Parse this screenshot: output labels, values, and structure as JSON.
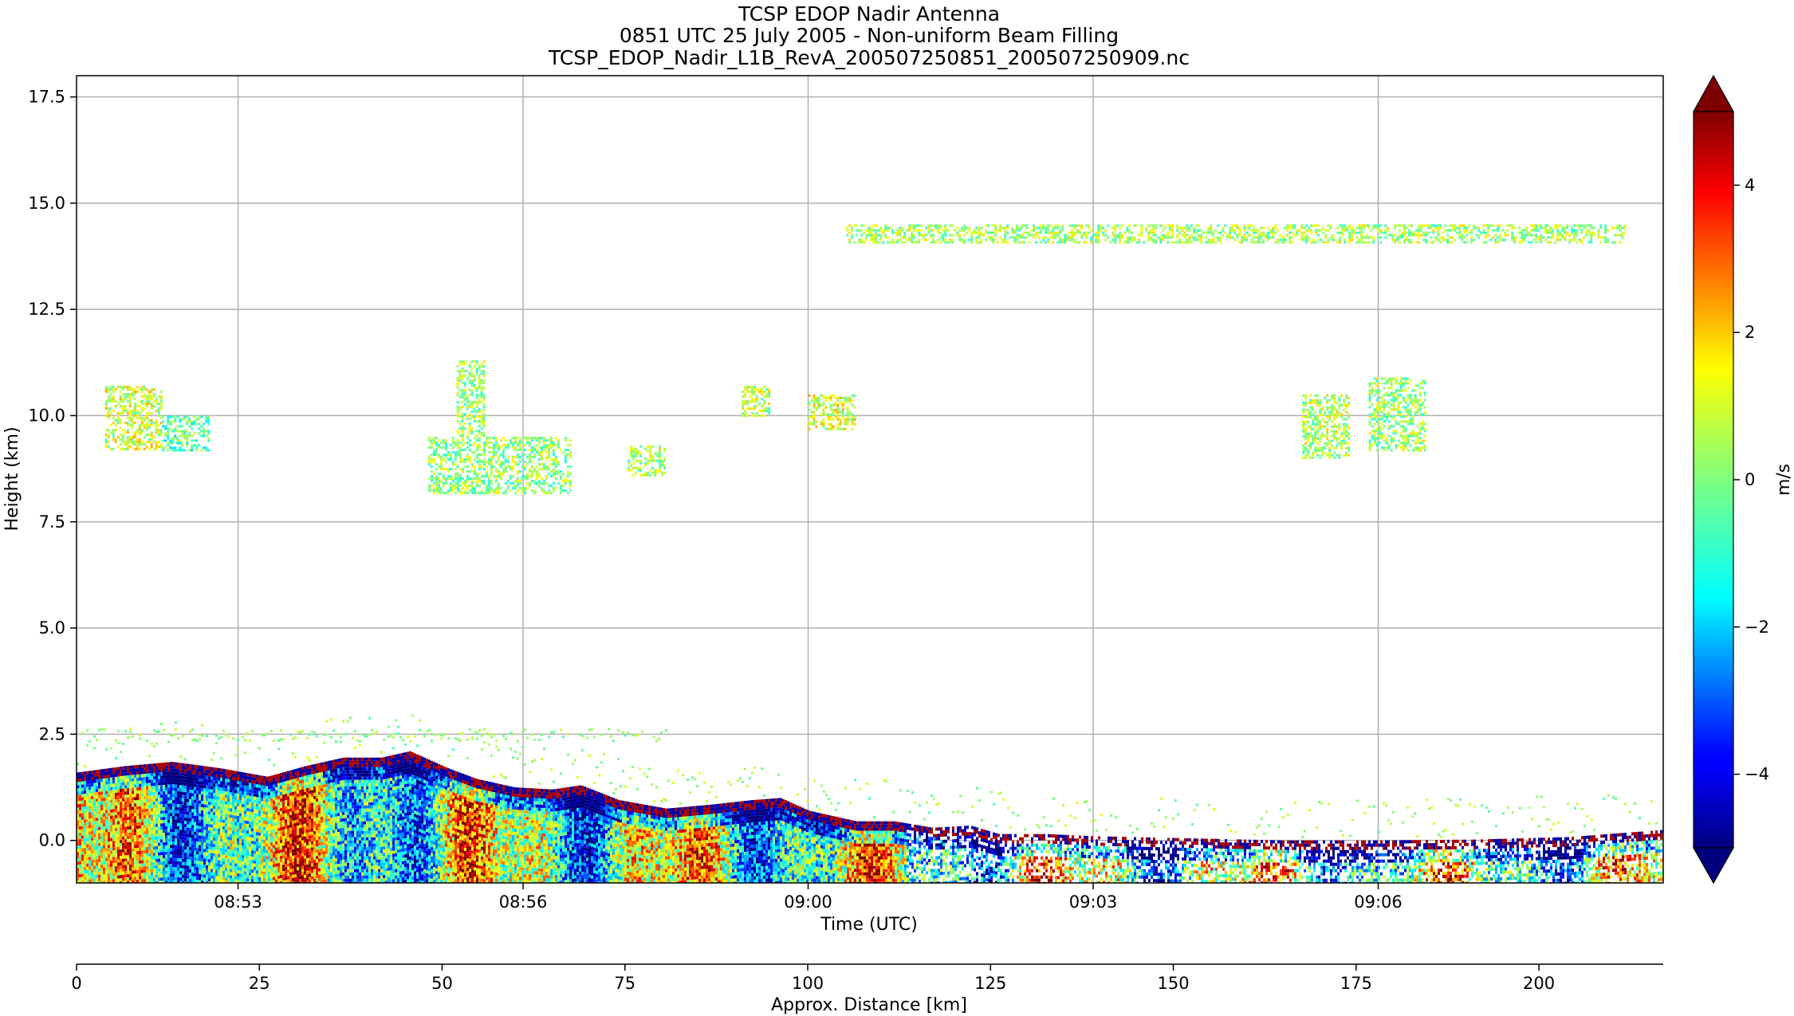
{
  "chart_data": {
    "type": "heatmap",
    "title": {
      "line1": "TCSP EDOP Nadir Antenna",
      "line2": "0851 UTC 25 July 2005 - Non-uniform Beam Filling",
      "line3": "TCSP_EDOP_Nadir_L1B_RevA_200507250851_200507250909.nc"
    },
    "xlabel": "Time (UTC)",
    "ylabel": "Height (km)",
    "x2label": "Approx. Distance [km]",
    "cbar_label": "m/s",
    "xlim_minutes": [
      531.3,
      548.0
    ],
    "ylim": [
      -1.0,
      18.0
    ],
    "x2lim": [
      0,
      217
    ],
    "clim": [
      -5,
      5
    ],
    "colormap": "jet",
    "colorbar_extend": "both",
    "grid": true,
    "x_ticks": [
      {
        "label": "08:53",
        "minute": 533
      },
      {
        "label": "08:56",
        "minute": 536
      },
      {
        "label": "09:00",
        "minute": 539
      },
      {
        "label": "09:03",
        "minute": 542
      },
      {
        "label": "09:06",
        "minute": 545
      }
    ],
    "y_ticks": [
      {
        "label": "0.0",
        "value": 0.0
      },
      {
        "label": "2.5",
        "value": 2.5
      },
      {
        "label": "5.0",
        "value": 5.0
      },
      {
        "label": "7.5",
        "value": 7.5
      },
      {
        "label": "10.0",
        "value": 10.0
      },
      {
        "label": "12.5",
        "value": 12.5
      },
      {
        "label": "15.0",
        "value": 15.0
      },
      {
        "label": "17.5",
        "value": 17.5
      }
    ],
    "x2_ticks": [
      {
        "label": "0",
        "value": 0
      },
      {
        "label": "25",
        "value": 25
      },
      {
        "label": "50",
        "value": 50
      },
      {
        "label": "75",
        "value": 75
      },
      {
        "label": "100",
        "value": 100
      },
      {
        "label": "125",
        "value": 125
      },
      {
        "label": "150",
        "value": 150
      },
      {
        "label": "175",
        "value": 175
      },
      {
        "label": "200",
        "value": 200
      }
    ],
    "cbar_ticks": [
      {
        "label": "4",
        "value": 4
      },
      {
        "label": "2",
        "value": 2
      },
      {
        "label": "0",
        "value": 0
      },
      {
        "label": "−2",
        "value": -2
      },
      {
        "label": "−4",
        "value": -4
      }
    ],
    "surface_echo_top_km": [
      [
        531.3,
        1.6
      ],
      [
        531.8,
        1.75
      ],
      [
        532.3,
        1.85
      ],
      [
        532.8,
        1.7
      ],
      [
        533.3,
        1.5
      ],
      [
        533.7,
        1.75
      ],
      [
        534.1,
        1.95
      ],
      [
        534.5,
        1.95
      ],
      [
        534.8,
        2.1
      ],
      [
        535.2,
        1.7
      ],
      [
        535.5,
        1.45
      ],
      [
        535.9,
        1.25
      ],
      [
        536.3,
        1.2
      ],
      [
        536.6,
        1.3
      ],
      [
        537.0,
        0.95
      ],
      [
        537.5,
        0.75
      ],
      [
        538.0,
        0.85
      ],
      [
        538.4,
        0.95
      ],
      [
        538.7,
        1.0
      ],
      [
        539.0,
        0.7
      ],
      [
        539.5,
        0.45
      ],
      [
        539.9,
        0.45
      ],
      [
        540.3,
        0.3
      ],
      [
        540.7,
        0.35
      ],
      [
        541.0,
        0.15
      ],
      [
        541.5,
        0.15
      ],
      [
        542.0,
        0.1
      ],
      [
        543.0,
        0.05
      ],
      [
        544.0,
        0.0
      ],
      [
        545.0,
        0.0
      ],
      [
        546.0,
        0.02
      ],
      [
        547.0,
        0.08
      ],
      [
        548.0,
        0.25
      ]
    ],
    "cloud_features": [
      {
        "minute_start": 531.6,
        "minute_end": 532.2,
        "bottom_km": 9.2,
        "top_km": 10.7,
        "mean_velocity": 0.8
      },
      {
        "minute_start": 532.2,
        "minute_end": 532.7,
        "bottom_km": 9.2,
        "top_km": 10.0,
        "mean_velocity": -0.5
      },
      {
        "minute_start": 535.3,
        "minute_end": 535.6,
        "bottom_km": 9.5,
        "top_km": 11.3,
        "mean_velocity": 0.3
      },
      {
        "minute_start": 535.0,
        "minute_end": 536.5,
        "bottom_km": 8.2,
        "top_km": 9.5,
        "mean_velocity": 0.2
      },
      {
        "minute_start": 537.1,
        "minute_end": 537.5,
        "bottom_km": 8.6,
        "top_km": 9.3,
        "mean_velocity": 0.4
      },
      {
        "minute_start": 538.3,
        "minute_end": 538.6,
        "bottom_km": 10.0,
        "top_km": 10.7,
        "mean_velocity": 0.6
      },
      {
        "minute_start": 539.0,
        "minute_end": 539.5,
        "bottom_km": 9.7,
        "top_km": 10.5,
        "mean_velocity": 0.9
      },
      {
        "minute_start": 544.2,
        "minute_end": 544.7,
        "bottom_km": 9.0,
        "top_km": 10.5,
        "mean_velocity": 0.5
      },
      {
        "minute_start": 544.9,
        "minute_end": 545.5,
        "bottom_km": 9.2,
        "top_km": 10.9,
        "mean_velocity": 0.3
      },
      {
        "minute_start": 539.4,
        "minute_end": 547.6,
        "bottom_km": 14.1,
        "top_km": 14.5,
        "mean_velocity": 0.4
      }
    ]
  }
}
